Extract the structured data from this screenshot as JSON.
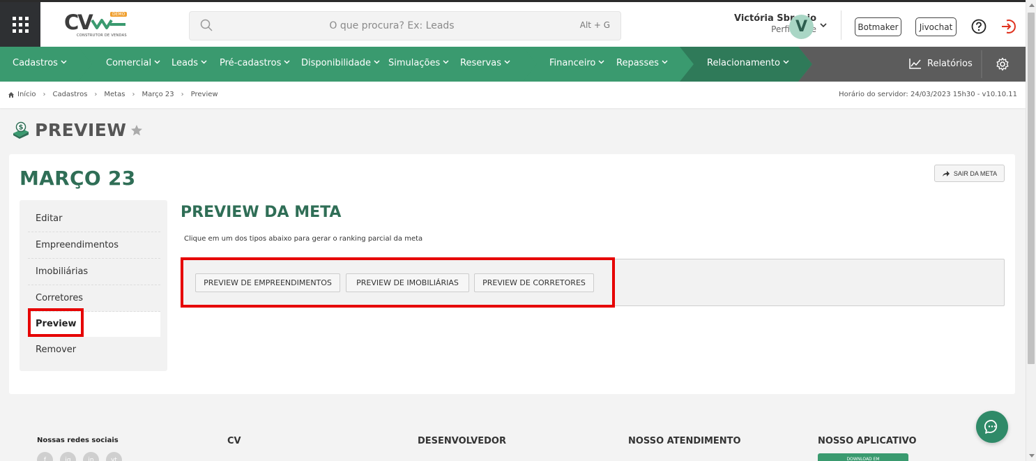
{
  "header": {
    "logo_text": "CV",
    "logo_badge": "DEMO",
    "logo_subtitle": "CONSTRUTOR DE VENDAS",
    "search_placeholder": "O que procura? Ex: Leads",
    "search_shortcut": "Alt + G",
    "user_name": "Victória Sbrogio",
    "user_role": "Perfil Teste",
    "avatar_letter": "V",
    "botmaker_label": "Botmaker",
    "jivochat_label": "Jivochat"
  },
  "nav": {
    "items": [
      "Cadastros",
      "Comercial",
      "Leads",
      "Pré-cadastros",
      "Disponibilidade",
      "Simulações",
      "Reservas",
      "Financeiro",
      "Repasses",
      "Relacionamento"
    ],
    "reports_label": "Relatórios"
  },
  "breadcrumb": {
    "items": [
      "Início",
      "Cadastros",
      "Metas",
      "Março 23",
      "Preview"
    ],
    "server_time": "Horário do servidor: 24/03/2023 15h30 - v10.10.11"
  },
  "page": {
    "title": "PREVIEW",
    "meta_title": "MARÇO 23",
    "exit_label": "SAIR DA META"
  },
  "sidebar": {
    "items": [
      "Editar",
      "Empreendimentos",
      "Imobiliárias",
      "Corretores",
      "Preview",
      "Remover"
    ],
    "active": "Preview"
  },
  "content": {
    "title": "PREVIEW DA META",
    "description": "Clique em um dos tipos abaixo para gerar o ranking parcial da meta",
    "buttons": [
      "PREVIEW DE EMPREENDIMENTOS",
      "PREVIEW DE IMOBILIÁRIAS",
      "PREVIEW DE CORRETORES"
    ]
  },
  "footer": {
    "social_title": "Nossas redes sociais",
    "social_icons": [
      "f",
      "ig",
      "in",
      "yt"
    ],
    "columns": [
      "CV",
      "DESENVOLVEDOR",
      "NOSSO ATENDIMENTO",
      "NOSSO APLICATIVO"
    ],
    "app_badge": "DOWNLOAD EM"
  },
  "colors": {
    "brand_green": "#3a9a6f",
    "dark_green": "#2f6e56",
    "highlight_red": "#e60000"
  }
}
